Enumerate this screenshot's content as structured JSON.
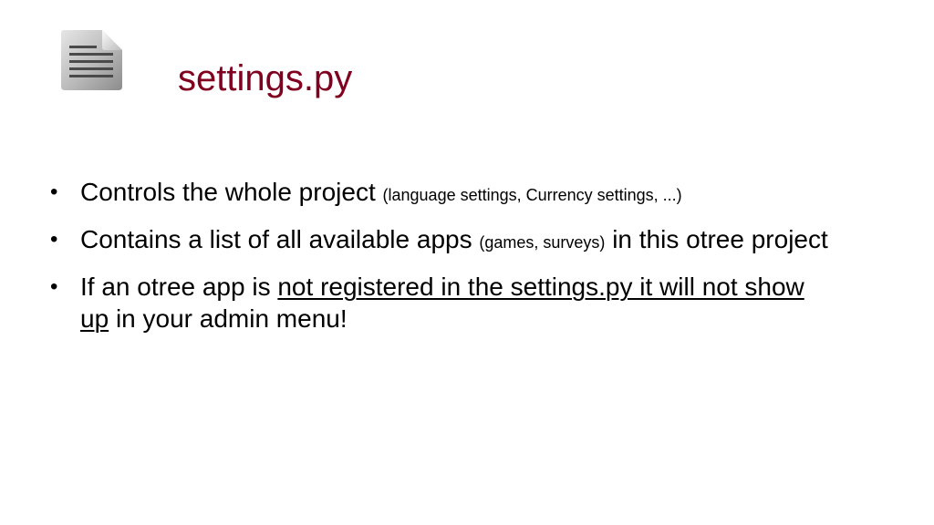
{
  "slide": {
    "title": "settings.py",
    "title_color": "#800020",
    "icon": "document-icon"
  },
  "bullets": [
    {
      "main": "Controls the whole project",
      "note": "(language settings, Currency settings, ...)"
    },
    {
      "pre": "Contains a list of all available apps",
      "note": "(games, surveys)",
      "post": "in this otree project"
    },
    {
      "pre": "If an otree app is",
      "underlined": "not registered in the settings.py it will not show up",
      "post": "in your admin menu!"
    }
  ],
  "bullet_symbol": "•"
}
